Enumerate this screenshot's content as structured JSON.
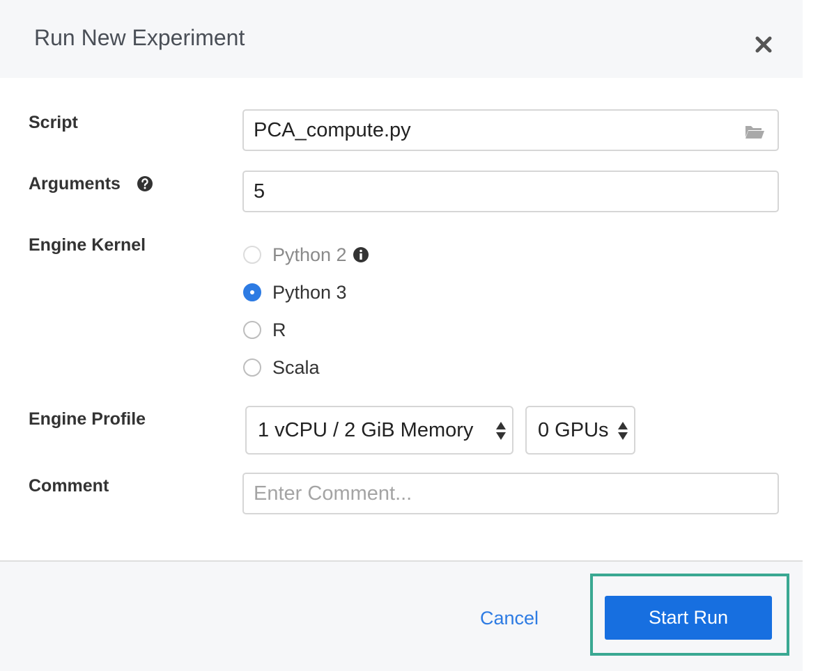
{
  "dialog": {
    "title": "Run New Experiment"
  },
  "form": {
    "script": {
      "label": "Script",
      "value": "PCA_compute.py"
    },
    "arguments": {
      "label": "Arguments",
      "value": "5"
    },
    "engine_kernel": {
      "label": "Engine Kernel",
      "options": [
        {
          "label": "Python 2",
          "selected": false,
          "disabled": true
        },
        {
          "label": "Python 3",
          "selected": true,
          "disabled": false
        },
        {
          "label": "R",
          "selected": false,
          "disabled": false
        },
        {
          "label": "Scala",
          "selected": false,
          "disabled": false
        }
      ]
    },
    "engine_profile": {
      "label": "Engine Profile",
      "cpu_memory": "1 vCPU / 2 GiB Memory",
      "gpus": "0 GPUs"
    },
    "comment": {
      "label": "Comment",
      "placeholder": "Enter Comment..."
    }
  },
  "footer": {
    "cancel_label": "Cancel",
    "start_label": "Start Run"
  },
  "colors": {
    "accent": "#176fe0",
    "highlight": "#3aa892",
    "header_bg": "#f6f7f9"
  }
}
